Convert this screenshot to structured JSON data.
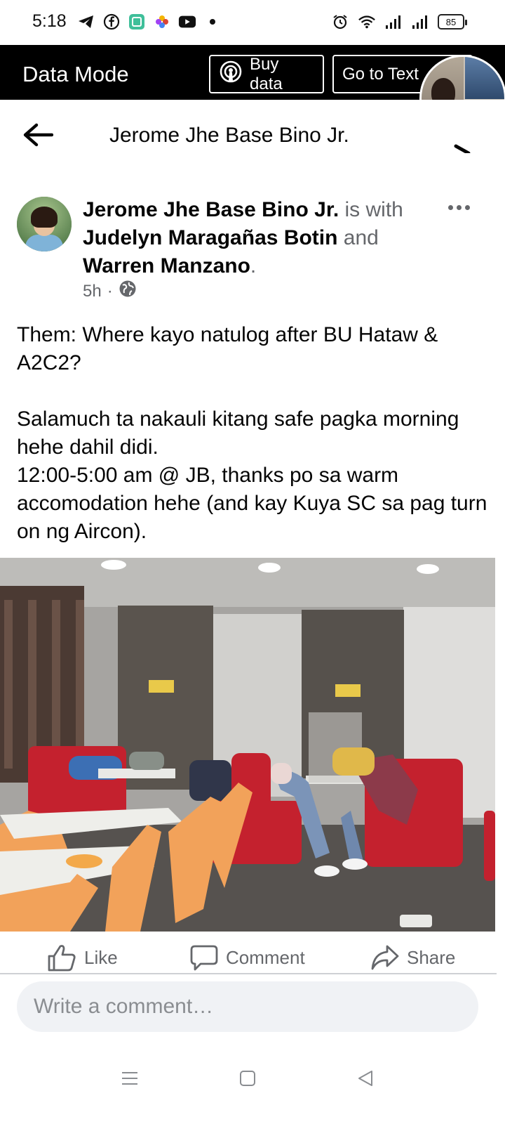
{
  "status_bar": {
    "time": "5:18",
    "battery": "85",
    "left_icons": [
      "telegram-icon",
      "facebook-icon",
      "app-icon",
      "pinwheel-icon",
      "youtube-icon",
      "dot-icon"
    ],
    "right_icons": [
      "alarm-icon",
      "wifi-icon",
      "signal-icon",
      "signal-icon",
      "battery-icon"
    ]
  },
  "data_mode": {
    "title": "Data Mode",
    "buy_data": "Buy data",
    "go_to_text": "Go to Text"
  },
  "header": {
    "title": "Jerome Jhe Base Bino Jr."
  },
  "post": {
    "author": "Jerome Jhe Base Bino Jr.",
    "with_text": " is with ",
    "tagged_1": "Judelyn Maragañas Botin",
    "and_text": " and ",
    "tagged_2": "Warren Manzano",
    "period": ".",
    "time": "5h",
    "sep": "·",
    "body": {
      "line_1": "Them: Where kayo natulog after BU Hataw & A2C2?",
      "line_2": "Salamuch ta nakauli kitang safe pagka morning hehe dahil didi.",
      "line_3": "12:00-5:00 am @ JB, thanks po sa warm accomodation hehe (and kay Kuya SC sa pag turn on ng Aircon)."
    }
  },
  "actions": {
    "like": "Like",
    "comment": "Comment",
    "share": "Share"
  },
  "comment_box": {
    "placeholder": "Write a comment…"
  },
  "colors": {
    "secondary_text": "#65676b",
    "primary_text": "#050505",
    "data_mode_bg": "#000000",
    "comment_bg": "#f0f2f5",
    "sofa_red": "#c4212e",
    "chair_orange": "#f2a25a"
  }
}
